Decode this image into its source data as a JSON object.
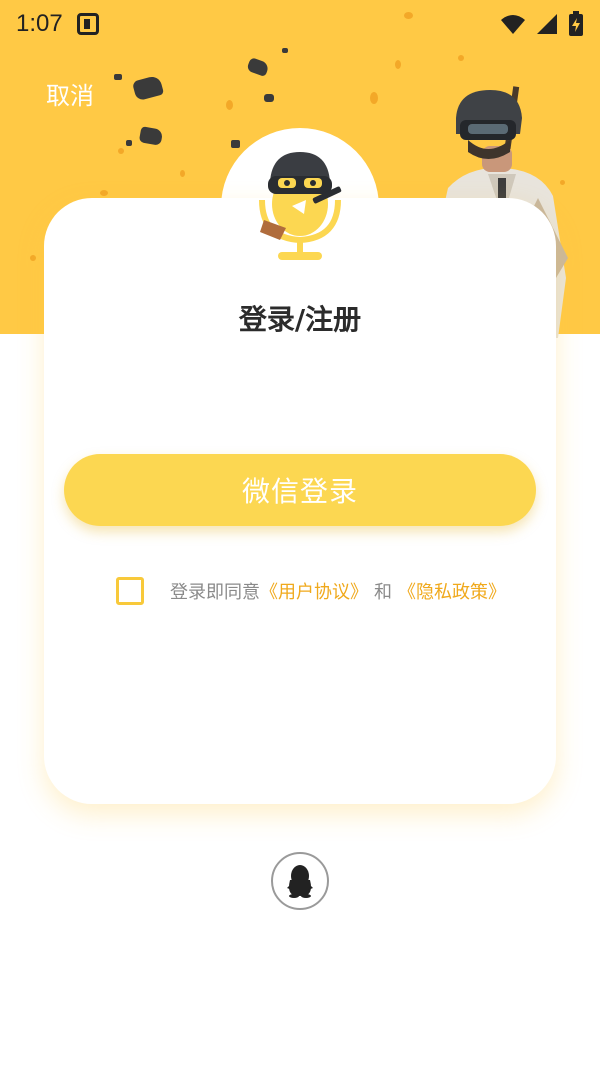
{
  "status_bar": {
    "time": "1:07",
    "icons": [
      "app-badge-icon",
      "wifi-icon",
      "signal-icon",
      "battery-charging-icon"
    ]
  },
  "header": {
    "cancel_label": "取消"
  },
  "card": {
    "title": "登录/注册",
    "wechat_login_label": "微信登录",
    "agreement": {
      "prefix": "登录即同意",
      "user_agreement": "《用户协议》",
      "and": "和",
      "privacy_policy": "《隐私政策》",
      "checked": false
    }
  },
  "alt_login": {
    "qq_icon": "qq-penguin-icon"
  },
  "colors": {
    "brand_yellow": "#ffc945",
    "button_yellow": "#fcd751",
    "link_orange": "#f0a91c"
  }
}
